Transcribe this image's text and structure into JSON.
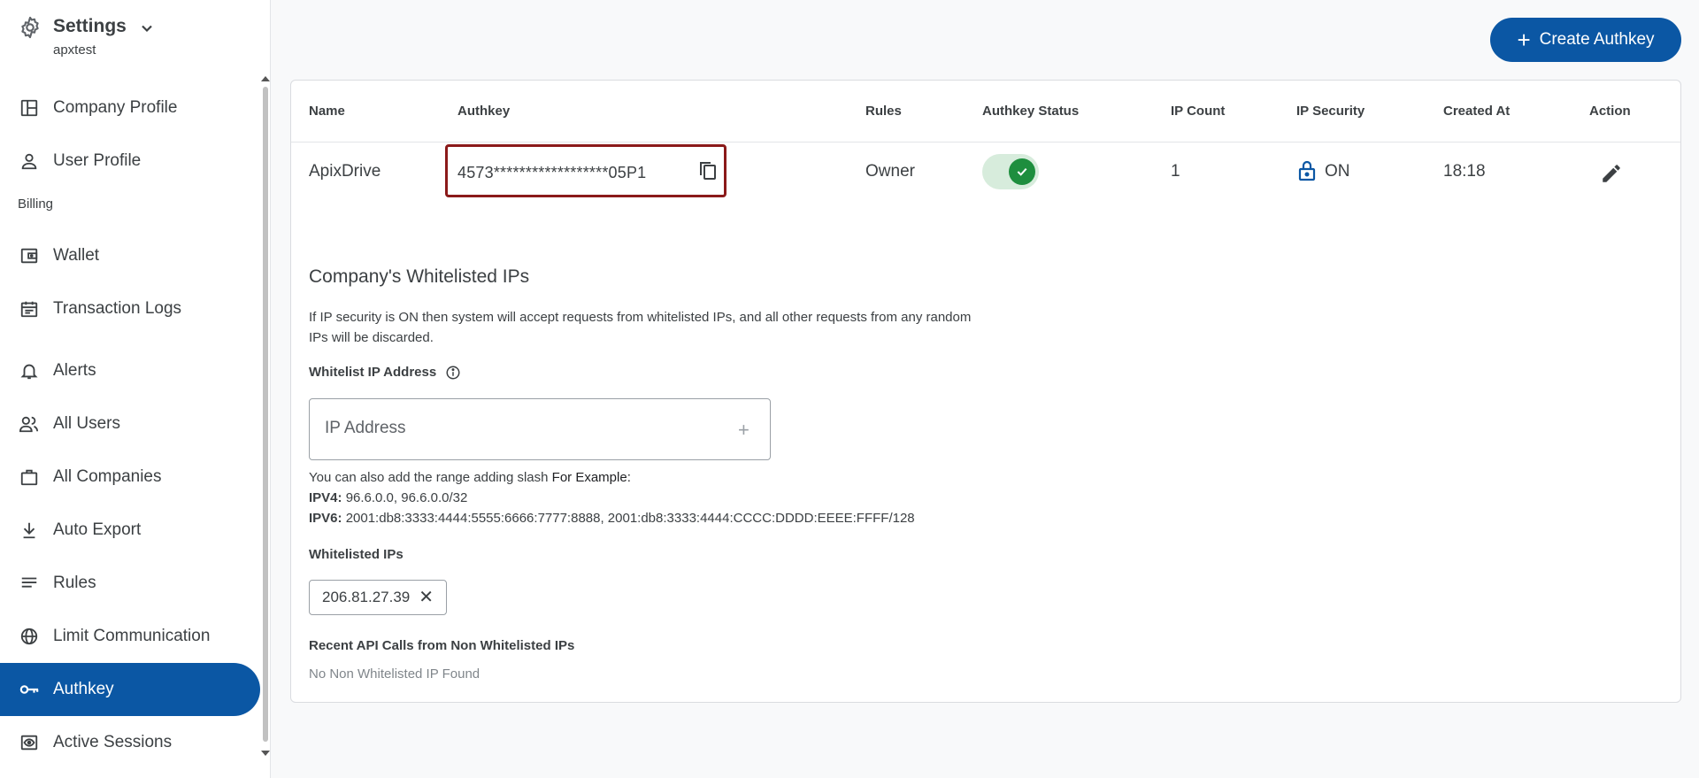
{
  "sidebar": {
    "title": "Settings",
    "subtitle": "apxtest",
    "billing_section": "Billing",
    "items": [
      {
        "label": "Company Profile",
        "icon": "company-profile-icon"
      },
      {
        "label": "User Profile",
        "icon": "user-icon"
      },
      {
        "label": "Wallet",
        "icon": "wallet-icon"
      },
      {
        "label": "Transaction Logs",
        "icon": "calendar-icon"
      },
      {
        "label": "Alerts",
        "icon": "bell-icon"
      },
      {
        "label": "All Users",
        "icon": "users-icon"
      },
      {
        "label": "All Companies",
        "icon": "briefcase-icon"
      },
      {
        "label": "Auto Export",
        "icon": "download-icon"
      },
      {
        "label": "Rules",
        "icon": "list-icon"
      },
      {
        "label": "Limit Communication",
        "icon": "globe-icon"
      },
      {
        "label": "Authkey",
        "icon": "key-icon",
        "active": true
      },
      {
        "label": "Active Sessions",
        "icon": "eye-icon"
      }
    ]
  },
  "header": {
    "create_button": "Create Authkey"
  },
  "table": {
    "columns": [
      "Name",
      "Authkey",
      "Rules",
      "Authkey Status",
      "IP Count",
      "IP Security",
      "Created At",
      "Action"
    ],
    "rows": [
      {
        "name": "ApixDrive",
        "authkey": "4573******************05P1",
        "rules": "Owner",
        "status_on": true,
        "ip_count": "1",
        "ip_security": "ON",
        "created_at": "18:18"
      }
    ]
  },
  "whitelist": {
    "title": "Company's Whitelisted IPs",
    "description": "If IP security is ON then system will accept requests from whitelisted IPs, and all other requests from any random IPs will be discarded.",
    "input_label": "Whitelist IP Address",
    "input_placeholder": "IP Address",
    "input_value": "",
    "hint_prefix": "You can also add the range adding slash",
    "hint_example": "For Example:",
    "ipv4_label": "IPV4:",
    "ipv4_value": "96.6.0.0, 96.6.0.0/32",
    "ipv6_label": "IPV6:",
    "ipv6_value": "2001:db8:3333:4444:5555:6666:7777:8888, 2001:db8:3333:4444:CCCC:DDDD:EEEE:FFFF/128",
    "whitelisted_label": "Whitelisted IPs",
    "whitelisted_ips": [
      "206.81.27.39"
    ],
    "recent_label": "Recent API Calls from Non Whitelisted IPs",
    "recent_empty": "No Non Whitelisted IP Found"
  },
  "colors": {
    "primary": "#0b57a4",
    "highlight_border": "#8b1a1a",
    "toggle_on": "#1e8e3e"
  }
}
